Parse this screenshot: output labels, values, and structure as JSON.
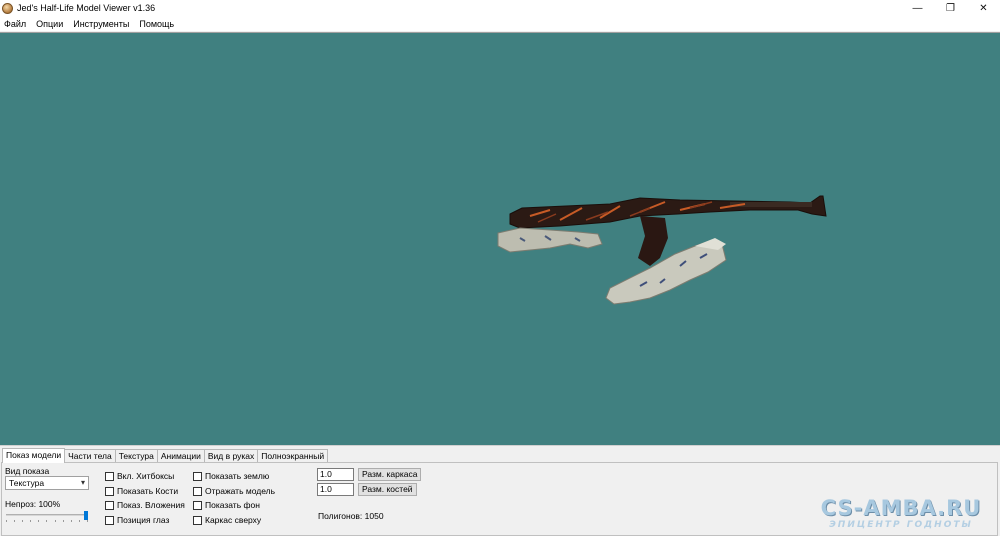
{
  "window": {
    "title": "Jed's Half-Life Model Viewer v1.36",
    "minimize": "—",
    "restore": "❐",
    "close": "✕"
  },
  "menu": [
    "Файл",
    "Опции",
    "Инструменты",
    "Помощь"
  ],
  "viewport": {
    "background": "#408080"
  },
  "tabs": [
    "Показ модели",
    "Части тела",
    "Текстура",
    "Анимации",
    "Вид в руках",
    "Полноэкранный"
  ],
  "model_panel": {
    "view_label": "Вид показа",
    "view_mode": "Текстура",
    "opacity_label": "Непроз: 100%",
    "opacity_value": 100,
    "checkboxes_col1": [
      "Вкл. Хитбоксы",
      "Показать Кости",
      "Показ. Вложения",
      "Позиция глаз"
    ],
    "checkboxes_col2": [
      "Показать землю",
      "Отражать модель",
      "Показать фон",
      "Каркас сверху"
    ],
    "wireframe_size_value": "1.0",
    "wireframe_size_button": "Разм. каркаса",
    "bone_size_value": "1.0",
    "bone_size_button": "Разм. костей",
    "polygons": "Полигонов: 1050"
  },
  "watermark": {
    "top": "CS-AMBA.RU",
    "bottom": "ЭПИЦЕНТР ГОДНОТЫ"
  }
}
